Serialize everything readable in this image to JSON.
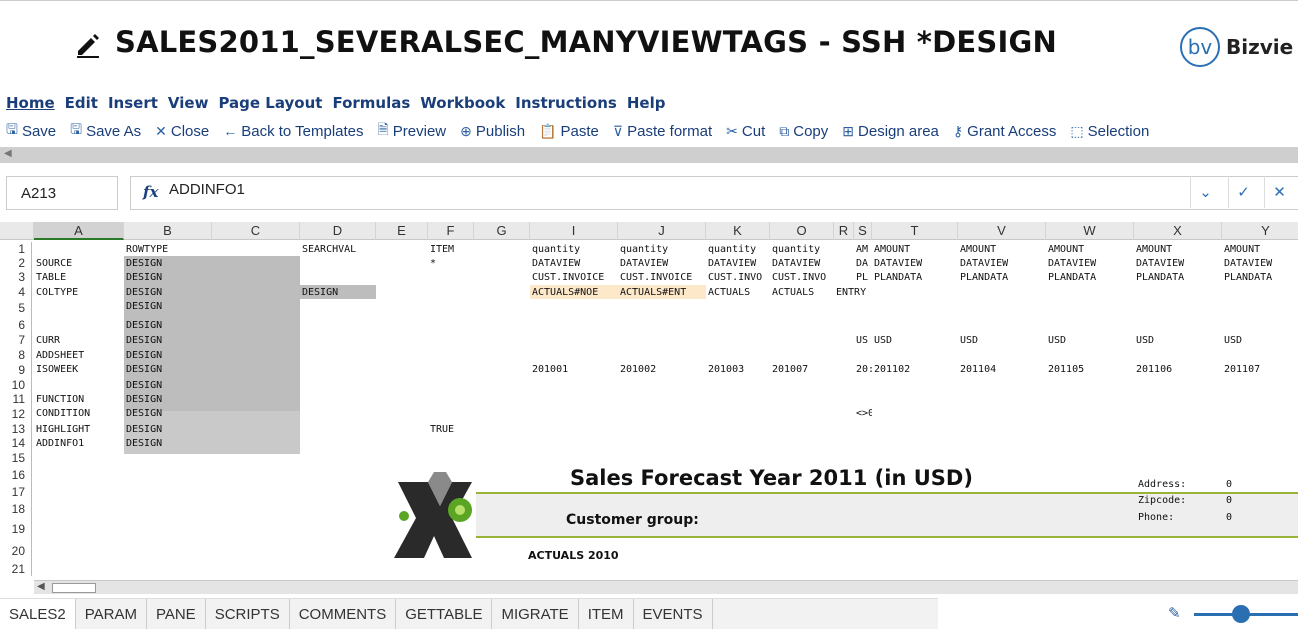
{
  "title_bar": {
    "title": "SALES2011_SEVERALSEC_MANYVIEWTAGS - SSH *DESIGN",
    "logo_mark": "bv",
    "logo_text": "Bizvie"
  },
  "menu": [
    "Home",
    "Edit",
    "Insert",
    "View",
    "Page Layout",
    "Formulas",
    "Workbook",
    "Instructions",
    "Help"
  ],
  "toolbar": [
    {
      "icon": "save-icon",
      "glyph": "🖫",
      "label": "Save"
    },
    {
      "icon": "save-as-icon",
      "glyph": "🖫",
      "label": "Save As"
    },
    {
      "icon": "close-icon",
      "glyph": "✕",
      "label": "Close"
    },
    {
      "icon": "back-arrow-icon",
      "glyph": "←",
      "label": "Back to Templates"
    },
    {
      "icon": "preview-icon",
      "glyph": "🗎",
      "label": "Preview"
    },
    {
      "icon": "globe-icon",
      "glyph": "⊕",
      "label": "Publish"
    },
    {
      "icon": "paste-icon",
      "glyph": "📋",
      "label": "Paste"
    },
    {
      "icon": "paste-format-icon",
      "glyph": "⊽",
      "label": "Paste format"
    },
    {
      "icon": "cut-icon",
      "glyph": "✂",
      "label": "Cut"
    },
    {
      "icon": "copy-icon",
      "glyph": "⧉",
      "label": "Copy"
    },
    {
      "icon": "design-area-icon",
      "glyph": "⊞",
      "label": "Design area"
    },
    {
      "icon": "key-icon",
      "glyph": "⚷",
      "label": "Grant Access"
    },
    {
      "icon": "selection-icon",
      "glyph": "⬚",
      "label": "Selection"
    }
  ],
  "formula": {
    "cell_ref": "A213",
    "fx": "fx",
    "value": "ADDINFO1"
  },
  "columns": [
    "A",
    "B",
    "C",
    "D",
    "E",
    "F",
    "G",
    "I",
    "J",
    "K",
    "O",
    "R",
    "S",
    "T",
    "V",
    "W",
    "X",
    "Y"
  ],
  "rows": [
    "1",
    "2",
    "3",
    "4",
    "5",
    "6",
    "7",
    "8",
    "9",
    "10",
    "11",
    "12",
    "13",
    "14",
    "15",
    "16",
    "17",
    "18",
    "19",
    "20",
    "21"
  ],
  "cells": {
    "B1": "ROWTYPE",
    "D1": "SEARCHVAL",
    "F1": "ITEM",
    "I1": "quantity",
    "J1": "quantity",
    "K1": "quantity",
    "O1": "quantity",
    "S1": "AM",
    "T1": "AMOUNT",
    "V1": "AMOUNT",
    "W1": "AMOUNT",
    "X1": "AMOUNT",
    "Y1": "AMOUNT",
    "A2": "SOURCE",
    "B2": "DESIGN",
    "F2": "*",
    "I2": "DATAVIEW",
    "J2": "DATAVIEW",
    "K2": "DATAVIEW",
    "O2": "DATAVIEW",
    "S2": "DA",
    "T2": "DATAVIEW",
    "V2": "DATAVIEW",
    "W2": "DATAVIEW",
    "X2": "DATAVIEW",
    "Y2": "DATAVIEW",
    "A3": "TABLE",
    "B3": "DESIGN",
    "I3": "CUST.INVOICE",
    "J3": "CUST.INVOICE",
    "K3": "CUST.INVO",
    "O3": "CUST.INVO",
    "S3": "PL",
    "T3": "PLANDATA",
    "V3": "PLANDATA",
    "W3": "PLANDATA",
    "X3": "PLANDATA",
    "Y3": "PLANDATA",
    "A4": "COLTYPE",
    "B4": "DESIGN",
    "D4": "DESIGN",
    "I4": "ACTUALS#NOE",
    "J4": "ACTUALS#ENT",
    "K4": "ACTUALS",
    "O4": "ACTUALS",
    "R4": "ENTRY",
    "B5": "DESIGN",
    "B6": "DESIGN",
    "A7": "CURR",
    "B7": "DESIGN",
    "S7": "US",
    "T7": "USD",
    "V7": "USD",
    "W7": "USD",
    "X7": "USD",
    "Y7": "USD",
    "A8": "ADDSHEET",
    "B8": "DESIGN",
    "A9": "ISOWEEK",
    "B9": "DESIGN",
    "I9": "201001",
    "J9": "201002",
    "K9": "201003",
    "O9": "201007",
    "S9": "20:",
    "T9": "201102",
    "V9": "201104",
    "W9": "201105",
    "X9": "201106",
    "Y9": "201107",
    "B10": "DESIGN",
    "A11": "FUNCTION",
    "B11": "DESIGN",
    "A12": "CONDITION",
    "B12": "DESIGN",
    "S12": "<>0",
    "A13": "HIGHLIGHT",
    "B13": "DESIGN",
    "F13": "TRUE",
    "A14": "ADDINFO1",
    "B14": "DESIGN"
  },
  "report": {
    "title": "Sales Forecast Year 2011 (in USD)",
    "customer_group": "Customer group:",
    "actuals": "ACTUALS 2010",
    "address_label": "Address:",
    "address_value": "0",
    "zipcode_label": "Zipcode:",
    "zipcode_value": "0",
    "phone_label": "Phone:",
    "phone_value": "0"
  },
  "sheet_tabs": [
    "SALES2",
    "PARAM",
    "PANE",
    "SCRIPTS",
    "COMMENTS",
    "GETTABLE",
    "MIGRATE",
    "ITEM",
    "EVENTS"
  ],
  "active_tab": "SALES2",
  "colors": {
    "menu_text": "#1a3e7a",
    "accent": "#2b6fb3",
    "design_shade": "#bdbdbd",
    "report_line": "#9ab43a"
  }
}
